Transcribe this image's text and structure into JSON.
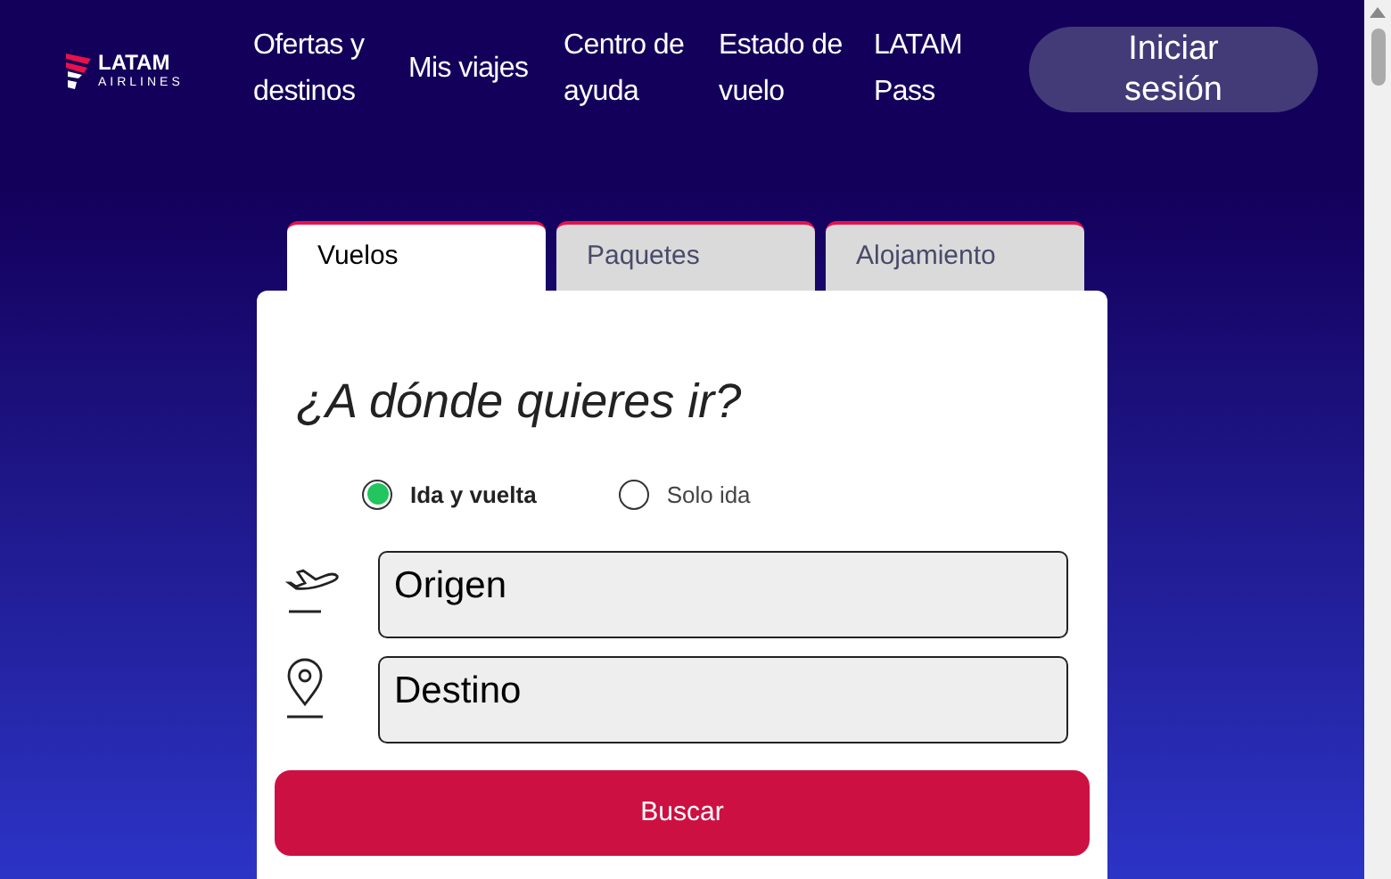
{
  "logo": {
    "brand": "LATAM",
    "sub": "AIRLINES"
  },
  "nav": [
    {
      "label": "Ofertas y destinos"
    },
    {
      "label": "Mis viajes"
    },
    {
      "label": "Centro de ayuda"
    },
    {
      "label": "Estado de vuelo"
    },
    {
      "label": "LATAM Pass"
    }
  ],
  "login_button": "Iniciar sesión",
  "tabs": [
    {
      "label": "Vuelos",
      "selected": true
    },
    {
      "label": "Paquetes",
      "selected": false
    },
    {
      "label": "Alojamiento",
      "selected": false
    }
  ],
  "heading": "¿A dónde quieres ir?",
  "trip_type": [
    {
      "label": "Ida y vuelta",
      "selected": true
    },
    {
      "label": "Solo ida",
      "selected": false
    }
  ],
  "fields": [
    {
      "kind": "origin",
      "placeholder": "Origen"
    },
    {
      "kind": "destination",
      "placeholder": "Destino"
    }
  ],
  "search_button": "Buscar"
}
